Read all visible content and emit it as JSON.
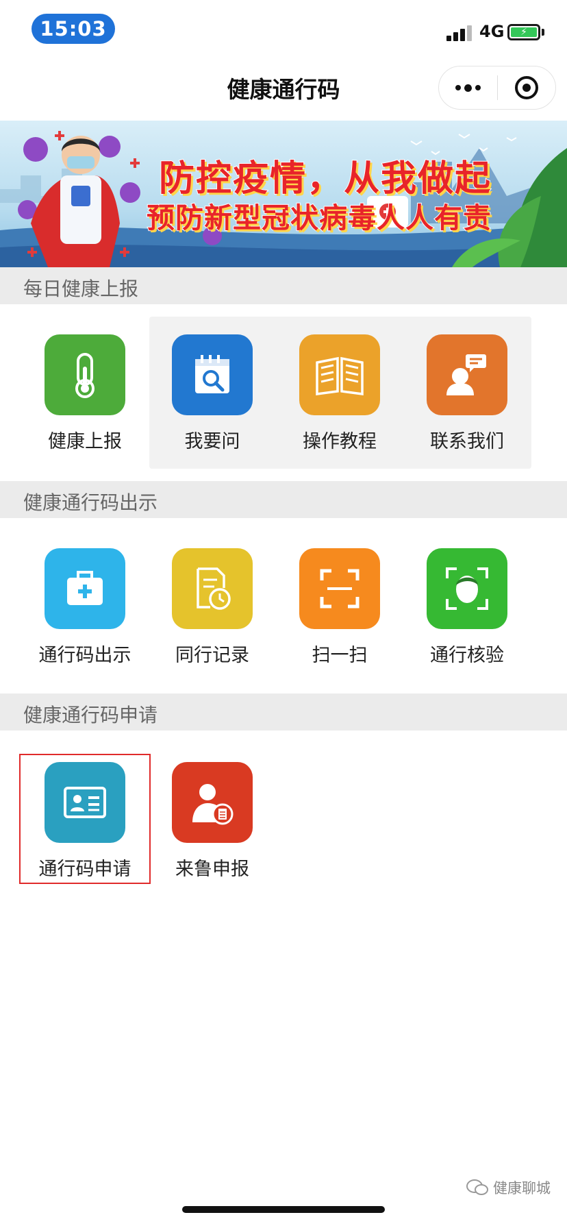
{
  "status_bar": {
    "time": "15:03",
    "network": "4G",
    "battery_charging_symbol": "⚡"
  },
  "nav": {
    "title": "健康通行码",
    "more_icon": "more-dots-icon",
    "close_icon": "close-circle-icon"
  },
  "banner": {
    "line1": "防控疫情，从我做起",
    "line2": "预防新型冠状病毒人人有责"
  },
  "sections": [
    {
      "title": "每日健康上报",
      "tiles": [
        {
          "label": "健康上报",
          "icon": "thermometer-icon",
          "color": "#4dab3a"
        },
        {
          "label": "我要问",
          "icon": "calendar-search-icon",
          "color": "#2278d0"
        },
        {
          "label": "操作教程",
          "icon": "book-icon",
          "color": "#eba22a"
        },
        {
          "label": "联系我们",
          "icon": "contact-person-icon",
          "color": "#e2752c"
        }
      ]
    },
    {
      "title": "健康通行码出示",
      "tiles": [
        {
          "label": "通行码出示",
          "icon": "medical-kit-icon",
          "color": "#2eb4ea"
        },
        {
          "label": "同行记录",
          "icon": "document-clock-icon",
          "color": "#e5c32c"
        },
        {
          "label": "扫一扫",
          "icon": "scan-icon",
          "color": "#f68a1e"
        },
        {
          "label": "通行核验",
          "icon": "face-scan-icon",
          "color": "#36b933"
        }
      ]
    },
    {
      "title": "健康通行码申请",
      "tiles": [
        {
          "label": "通行码申请",
          "icon": "id-card-icon",
          "color": "#2aa0c0"
        },
        {
          "label": "来鲁申报",
          "icon": "person-document-icon",
          "color": "#d93a22"
        }
      ]
    }
  ],
  "watermark": {
    "text": "健康聊城"
  }
}
